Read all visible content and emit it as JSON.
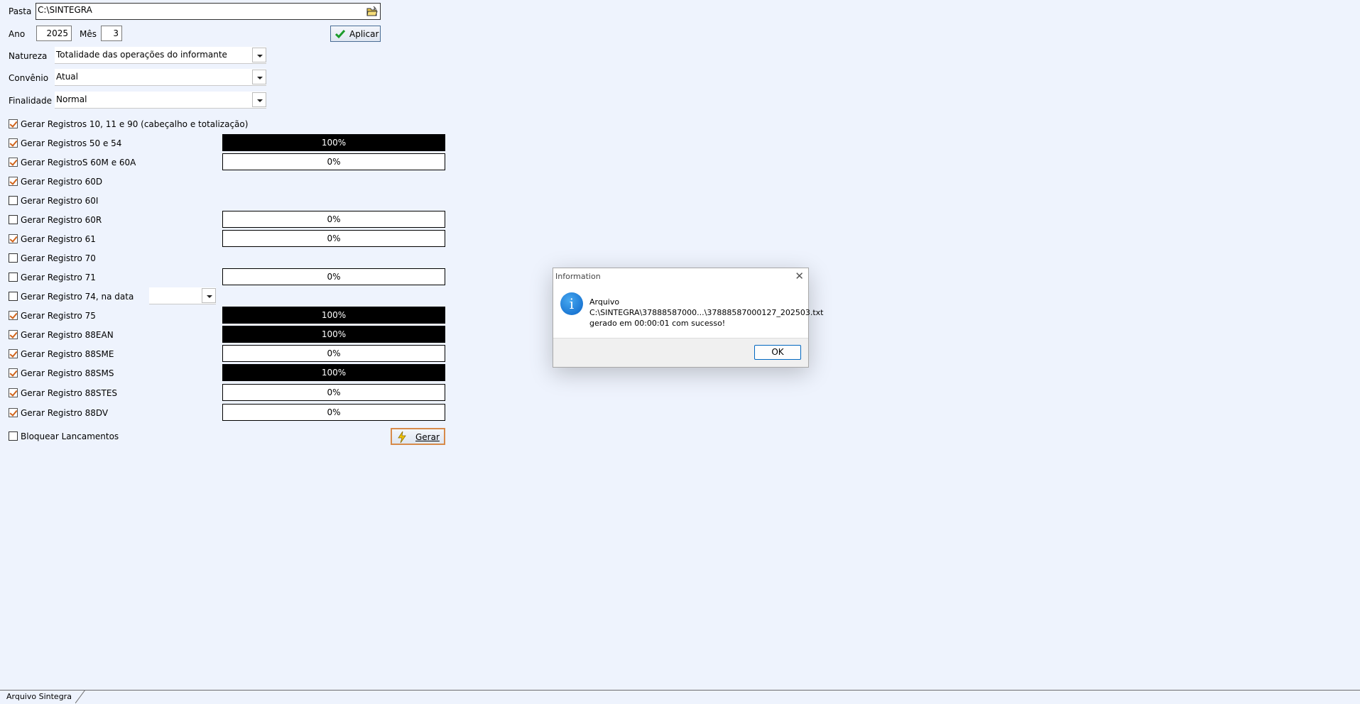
{
  "form": {
    "pasta_label": "Pasta",
    "pasta_value": "C:\\SINTEGRA",
    "ano_label": "Ano",
    "ano_value": "2025",
    "mes_label": "Mês",
    "mes_value": "3",
    "aplicar_label": "Aplicar",
    "natureza_label": "Natureza",
    "natureza_value": "Totalidade das operações do informante",
    "convenio_label": "Convênio",
    "convenio_value": "Atual",
    "finalidade_label": "Finalidade",
    "finalidade_value": "Normal"
  },
  "registros": [
    {
      "label": "Gerar Registros 10, 11 e 90 (cabeçalho e totalização)",
      "checked": true,
      "progress": null
    },
    {
      "label": "Gerar Registros 50 e 54",
      "checked": true,
      "progress": 100,
      "progress_text": "100%"
    },
    {
      "label": "Gerar RegistroS 60M e 60A",
      "checked": true,
      "progress": 0,
      "progress_text": "0%"
    },
    {
      "label": "Gerar Registro 60D",
      "checked": true,
      "progress": null
    },
    {
      "label": "Gerar Registro 60I",
      "checked": false,
      "progress": null
    },
    {
      "label": "Gerar Registro 60R",
      "checked": false,
      "progress": 0,
      "progress_text": "0%"
    },
    {
      "label": "Gerar Registro 61",
      "checked": true,
      "progress": 0,
      "progress_text": "0%"
    },
    {
      "label": "Gerar Registro 70",
      "checked": false,
      "progress": null
    },
    {
      "label": "Gerar Registro 71",
      "checked": false,
      "progress": 0,
      "progress_text": "0%"
    },
    {
      "label": "Gerar Registro 74, na data",
      "checked": false,
      "progress": null
    },
    {
      "label": "Gerar Registro 75",
      "checked": true,
      "progress": 100,
      "progress_text": "100%"
    },
    {
      "label": "Gerar Registro 88EAN",
      "checked": true,
      "progress": 100,
      "progress_text": "100%"
    },
    {
      "label": "Gerar Registro 88SME",
      "checked": true,
      "progress": 0,
      "progress_text": "0%"
    },
    {
      "label": "Gerar Registro 88SMS",
      "checked": true,
      "progress": 100,
      "progress_text": "100%"
    },
    {
      "label": "Gerar Registro 88STES",
      "checked": true,
      "progress": 0,
      "progress_text": "0%"
    },
    {
      "label": "Gerar Registro 88DV",
      "checked": true,
      "progress": 0,
      "progress_text": "0%"
    }
  ],
  "bloquear": {
    "label": "Bloquear Lancamentos",
    "checked": false
  },
  "gerar_label": "Gerar",
  "dialog": {
    "title": "Information",
    "close_glyph": "✕",
    "icon_glyph": "i",
    "line1": "Arquivo",
    "line2": "C:\\SINTEGRA\\37888587000...\\37888587000127_202503.txt",
    "line3": "gerado em 00:00:01 com sucesso!",
    "ok_label": "OK"
  },
  "tab": {
    "label": "Arquivo Sintegra"
  },
  "colors": {
    "accent": "#0067c0",
    "check": "#d0641c",
    "background": "#eef3fd"
  }
}
